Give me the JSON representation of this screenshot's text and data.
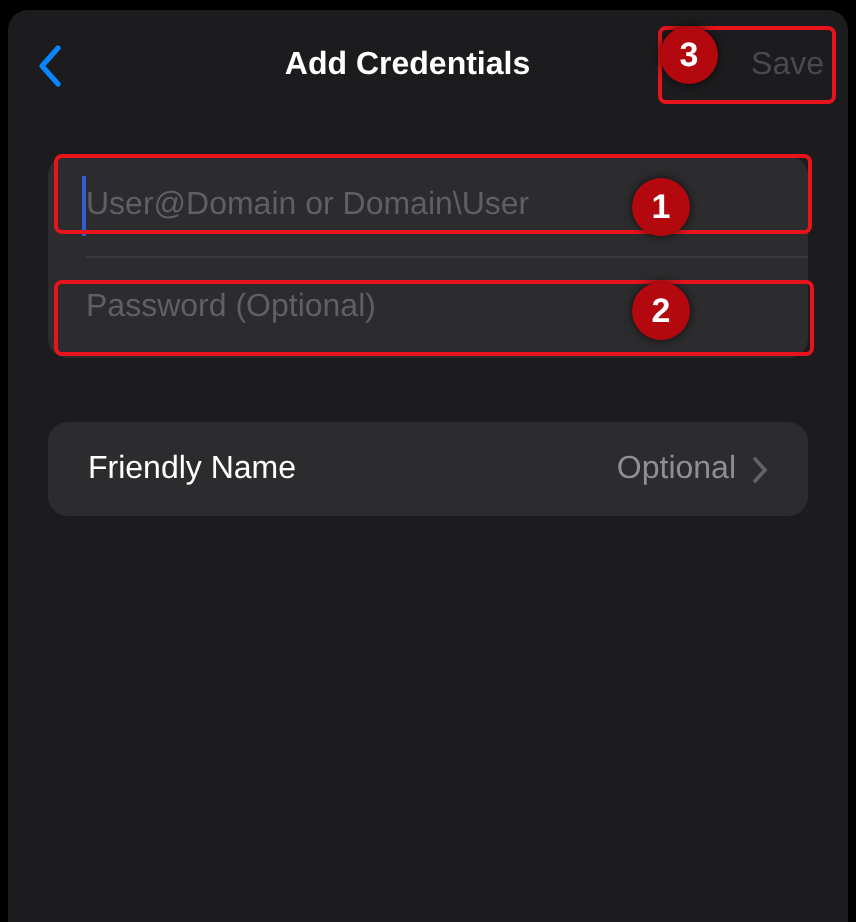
{
  "nav": {
    "title": "Add Credentials",
    "save": {
      "label": "Save",
      "disabled": true,
      "annotation": "3"
    }
  },
  "fields": [
    {
      "placeholder": "User@Domain or Domain\\User",
      "focused": true,
      "annotation": "1"
    },
    {
      "placeholder": "Password (Optional)",
      "focused": false,
      "annotation": "2"
    }
  ],
  "friendly_name": {
    "label": "Friendly Name",
    "value": "Optional"
  }
}
